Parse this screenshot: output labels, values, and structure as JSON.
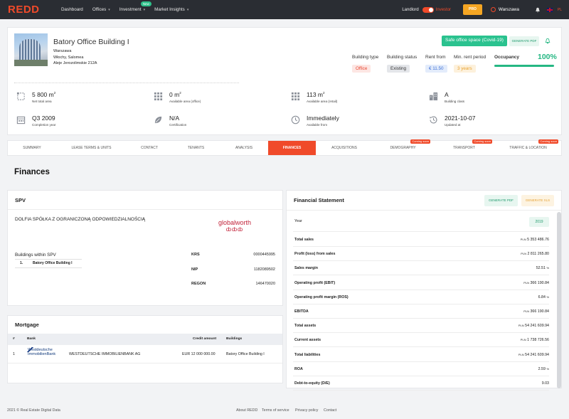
{
  "brand": {
    "logo": "REDD",
    "accent": "#f04a2a",
    "green": "#25b783"
  },
  "nav": {
    "items": [
      {
        "label": "Dashboard",
        "chevron": false
      },
      {
        "label": "Offices",
        "chevron": true
      },
      {
        "label": "Investment",
        "chevron": true,
        "badge": "New"
      },
      {
        "label": "Market Insights",
        "chevron": true
      }
    ],
    "landlord": "Landlord",
    "investor": "Investor",
    "pro": "PRO",
    "city": "Warszawa",
    "lang": "PL"
  },
  "building": {
    "name": "Batory Office Building I",
    "address": [
      "Warszawa",
      "Włochy, Salomea",
      "Aleje Jerozolimskie 212A"
    ],
    "covid_badge": "Safe office space (Covid-19)",
    "generate_pdf": "GENERATE PDF",
    "meta": [
      {
        "label": "Building type",
        "value": "Office",
        "bg": "#fde6e3",
        "fg": "#e8452f"
      },
      {
        "label": "Building status",
        "value": "Existing",
        "bg": "#e4e6ea",
        "fg": "#333333"
      },
      {
        "label": "Rent from",
        "value": "€ 11.50",
        "bg": "#e3ecfb",
        "fg": "#3d6fd6"
      },
      {
        "label": "Min. rent period",
        "value": "3 years",
        "bg": "#fdf1dc",
        "fg": "#e8a12f"
      }
    ],
    "occupancy_label": "Occupancy",
    "occupancy_value": "100%",
    "occupancy_fraction": 1.0,
    "stats": [
      {
        "value": "5 800",
        "unit": "m2",
        "label": "Net total area",
        "icon": "area-icon"
      },
      {
        "value": "0",
        "unit": "m2",
        "label": "Available area (office)",
        "icon": "grid-icon"
      },
      {
        "value": "113",
        "unit": "m2",
        "label": "Available area (retail)",
        "icon": "grid-icon"
      },
      {
        "value": "A",
        "unit": "",
        "label": "Building class",
        "icon": "building-icon"
      },
      {
        "value": "Q3 2009",
        "unit": "",
        "label": "Completion year",
        "icon": "calendar-icon"
      },
      {
        "value": "N/A",
        "unit": "",
        "label": "Certification",
        "icon": "leaf-icon"
      },
      {
        "value": "Immediately",
        "unit": "",
        "label": "Available from",
        "icon": "clock-icon"
      },
      {
        "value": "2021-10-07",
        "unit": "",
        "label": "Updated at",
        "icon": "history-icon"
      }
    ]
  },
  "tabs": [
    {
      "label": "Summary",
      "active": false,
      "soon": ""
    },
    {
      "label": "Lease terms & units",
      "active": false,
      "soon": ""
    },
    {
      "label": "Contact",
      "active": false,
      "soon": ""
    },
    {
      "label": "Tenants",
      "active": false,
      "soon": ""
    },
    {
      "label": "Analysis",
      "active": false,
      "soon": ""
    },
    {
      "label": "Finances",
      "active": true,
      "soon": ""
    },
    {
      "label": "Acquisitions",
      "active": false,
      "soon": ""
    },
    {
      "label": "Demography",
      "active": false,
      "soon": "Coming soon"
    },
    {
      "label": "Transport",
      "active": false,
      "soon": "Coming soon"
    },
    {
      "label": "Traffic & Location",
      "active": false,
      "soon": "Coming soon"
    }
  ],
  "page_title": "Finances",
  "spv": {
    "title": "SPV",
    "company": "DOLFIA SPÓŁKA Z OGRANICZONĄ ODPOWIEDZIALNOŚCIĄ",
    "logo_text": "globalworth",
    "buildings_title": "Buildings within SPV",
    "buildings": [
      {
        "no": "1.",
        "name": "Batory Office Building I"
      }
    ],
    "registry": [
      {
        "key": "KRS",
        "value": "0000445995"
      },
      {
        "key": "NIP",
        "value": "1182089502"
      },
      {
        "key": "REGON",
        "value": "146470020"
      }
    ]
  },
  "mortgage": {
    "title": "Mortgage",
    "headers": {
      "no": "#",
      "bank": "Bank",
      "amount": "Credit amount",
      "buildings": "Buildings"
    },
    "rows": [
      {
        "no": "1",
        "logo": [
          "Westdeutsche",
          "ImmobilienBank"
        ],
        "bank": "WESTDEUTSCHE IMMOBILIENBANK AG",
        "amount": "EUR 12 000 000.00",
        "buildings": "Batory Office Building I"
      }
    ]
  },
  "financial": {
    "title": "Financial Statement",
    "generate_pdf": "GENERATE PDF",
    "generate_xls": "GENERATE XLS",
    "year_label": "Year",
    "year": "2019",
    "rows": [
      {
        "key": "Total sales",
        "prefix": "PLN",
        "value": "5 353 486.76",
        "suffix": ""
      },
      {
        "key": "Profit (loss) from sales",
        "prefix": "PLN",
        "value": "2 811 265.80",
        "suffix": ""
      },
      {
        "key": "Sales margin",
        "prefix": "",
        "value": "52.51",
        "suffix": "%"
      },
      {
        "key": "Operating profit (EBIT)",
        "prefix": "PLN",
        "value": "366 190.84",
        "suffix": ""
      },
      {
        "key": "Operating profit margin (ROS)",
        "prefix": "",
        "value": "6.84",
        "suffix": "%"
      },
      {
        "key": "EBITDA",
        "prefix": "PLN",
        "value": "366 190.84",
        "suffix": ""
      },
      {
        "key": "Total assets",
        "prefix": "PLN",
        "value": "54 241 609.94",
        "suffix": ""
      },
      {
        "key": "Current assets",
        "prefix": "PLN",
        "value": "1 738 726.56",
        "suffix": ""
      },
      {
        "key": "Total liabilities",
        "prefix": "PLN",
        "value": "54 241 609.94",
        "suffix": ""
      },
      {
        "key": "ROA",
        "prefix": "",
        "value": "2.59",
        "suffix": "%"
      },
      {
        "key": "Debt-to-equity (D/E)",
        "prefix": "",
        "value": "9.03",
        "suffix": ""
      }
    ]
  },
  "footer": {
    "copyright": "2021 © Real Estate Digital Data",
    "links": [
      "About REDD",
      "Terms of service",
      "Privacy policy",
      "Contact"
    ]
  }
}
